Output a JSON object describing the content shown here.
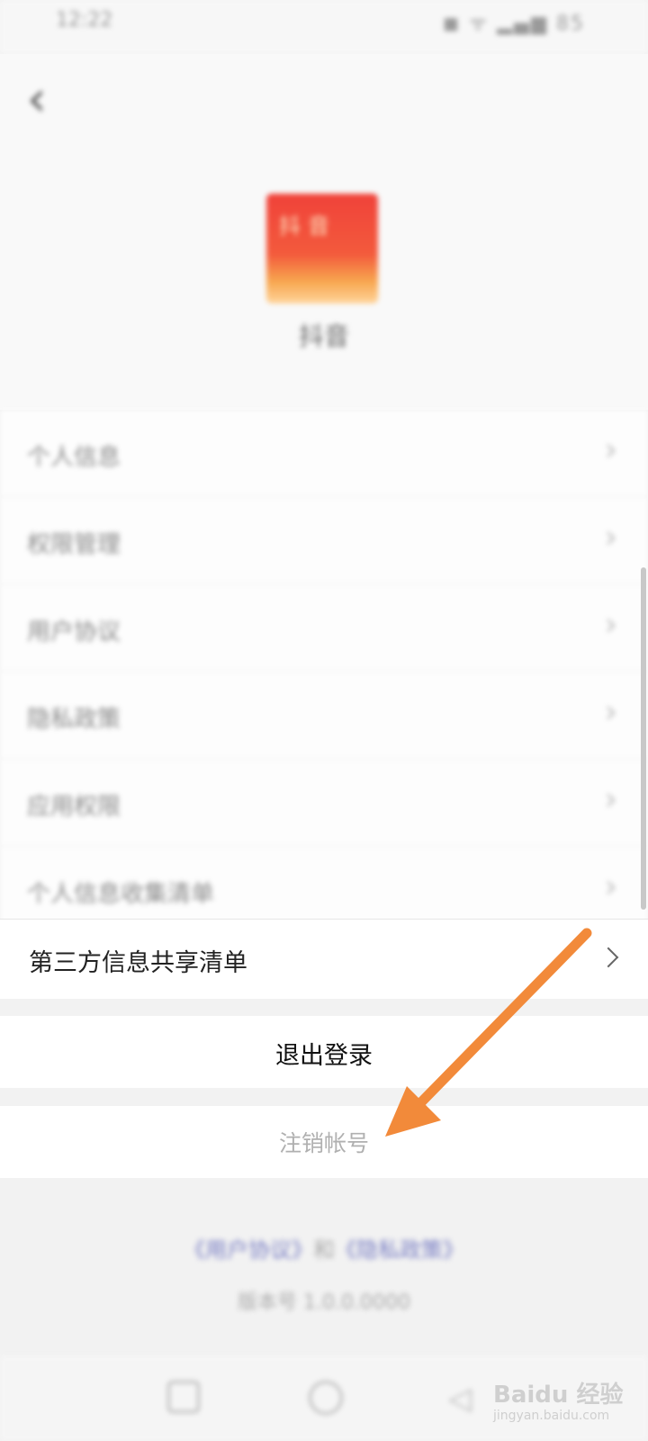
{
  "status_bar": {
    "time": "12:22",
    "icons": "◼ ᯤ ▂▄▆ 85"
  },
  "header": {
    "back_glyph": "‹",
    "app_name": "抖音",
    "logo_text": "抖音"
  },
  "menu": {
    "items": [
      {
        "label": "个人信息"
      },
      {
        "label": "权限管理"
      },
      {
        "label": "用户协议"
      },
      {
        "label": "隐私政策"
      },
      {
        "label": "应用权限"
      },
      {
        "label": "个人信息收集清单"
      }
    ],
    "chevron": "›"
  },
  "share_list": {
    "label": "第三方信息共享清单"
  },
  "logout": {
    "label": "退出登录"
  },
  "cancel_account": {
    "label": "注销帐号"
  },
  "footer": {
    "user_agreement": "《用户协议》",
    "and": "和",
    "privacy_policy": "《隐私政策》",
    "version": "版本号 1.0.0.0000"
  },
  "watermark": {
    "main": "Baidu 经验",
    "sub": "jingyan.baidu.com"
  },
  "colors": {
    "arrow": "#f28a3a",
    "link": "#7a7fc4",
    "logo_top": "#f0423a",
    "logo_bottom": "#ffd49a"
  }
}
